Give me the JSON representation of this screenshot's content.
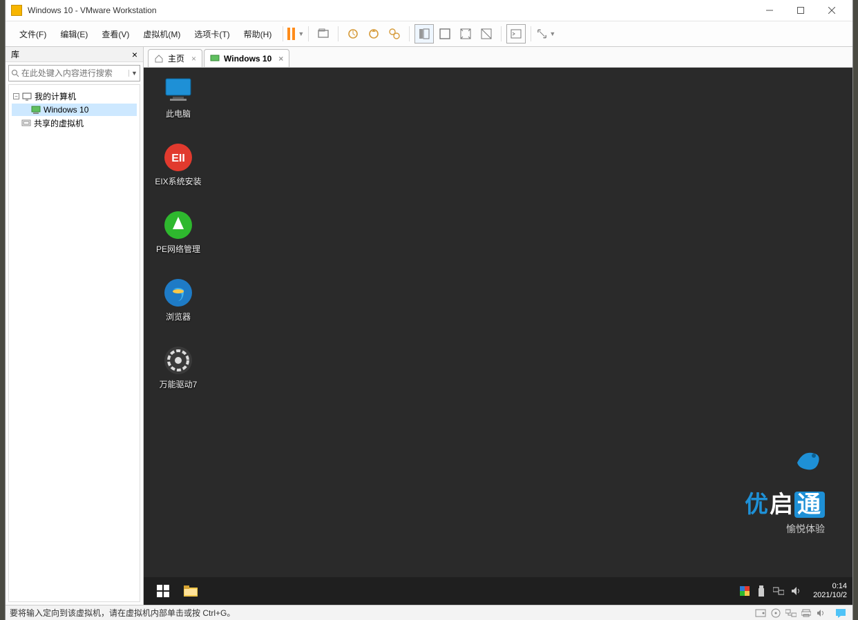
{
  "window_title": "Windows 10 - VMware Workstation",
  "menubar": {
    "file": "文件(F)",
    "edit": "编辑(E)",
    "view": "查看(V)",
    "vm": "虚拟机(M)",
    "tabs": "选项卡(T)",
    "help": "帮助(H)"
  },
  "sidebar": {
    "title": "库",
    "search_placeholder": "在此处键入内容进行搜索",
    "tree": {
      "root": "我的计算机",
      "vm": "Windows 10",
      "shared": "共享的虚拟机"
    }
  },
  "tabs": {
    "home": "主页",
    "vm": "Windows 10"
  },
  "desktop": {
    "icon1": "此电脑",
    "icon2": "EIX系统安装",
    "icon3": "PE网络管理",
    "icon4": "浏览器",
    "icon5": "万能驱动7"
  },
  "brand": {
    "t1a": "优",
    "t1b": "启",
    "t1c": "通",
    "t2": "愉悦体验"
  },
  "taskbar": {
    "time": "0:14",
    "date": "2021/10/2"
  },
  "statusbar": {
    "text": "要将输入定向到该虚拟机，请在虚拟机内部单击或按 Ctrl+G。"
  }
}
